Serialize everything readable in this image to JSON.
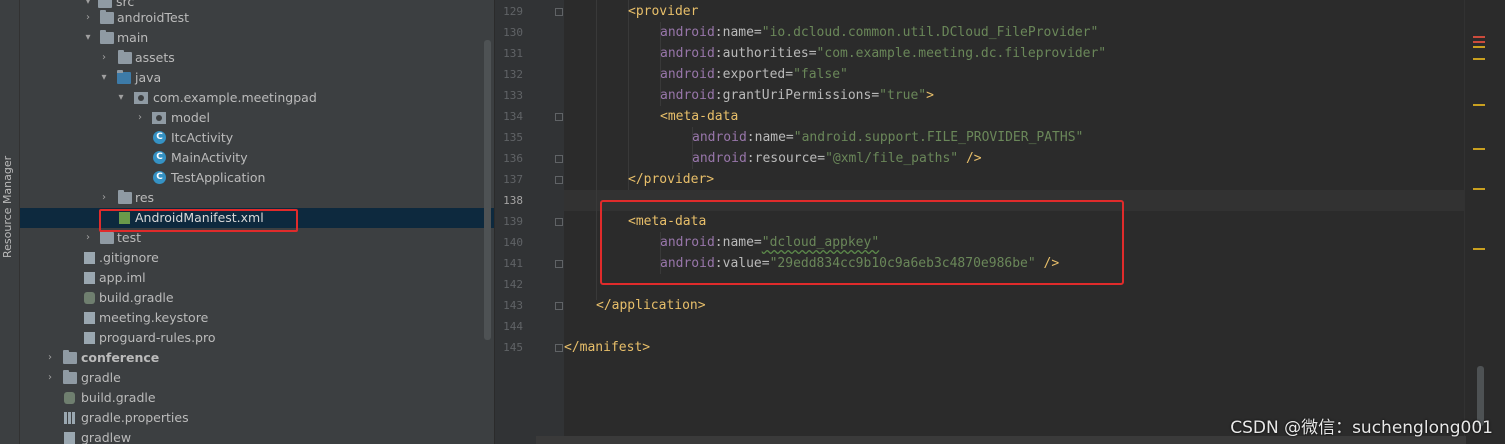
{
  "toolstrip": {
    "label": "Resource Manager"
  },
  "tree": {
    "items": [
      {
        "label": "src",
        "chev": "▾"
      },
      {
        "label": "androidTest",
        "chev": "›"
      },
      {
        "label": "main",
        "chev": "▾"
      },
      {
        "label": "assets",
        "chev": "›"
      },
      {
        "label": "java",
        "chev": "▾"
      },
      {
        "label": "com.example.meetingpad",
        "chev": "▾"
      },
      {
        "label": "model",
        "chev": "›"
      },
      {
        "label": "ItcActivity",
        "chev": ""
      },
      {
        "label": "MainActivity",
        "chev": ""
      },
      {
        "label": "TestApplication",
        "chev": ""
      },
      {
        "label": "res",
        "chev": "›"
      },
      {
        "label": "AndroidManifest.xml",
        "chev": ""
      },
      {
        "label": "test",
        "chev": "›"
      },
      {
        "label": ".gitignore",
        "chev": ""
      },
      {
        "label": "app.iml",
        "chev": ""
      },
      {
        "label": "build.gradle",
        "chev": ""
      },
      {
        "label": "meeting.keystore",
        "chev": ""
      },
      {
        "label": "proguard-rules.pro",
        "chev": ""
      },
      {
        "label": "conference",
        "chev": "›"
      },
      {
        "label": "gradle",
        "chev": "›"
      },
      {
        "label": "build.gradle",
        "chev": ""
      },
      {
        "label": "gradle.properties",
        "chev": ""
      },
      {
        "label": "gradlew",
        "chev": ""
      }
    ],
    "class_glyph": "C"
  },
  "editor": {
    "line_numbers": [
      "129",
      "130",
      "131",
      "132",
      "133",
      "134",
      "135",
      "136",
      "137",
      "138",
      "139",
      "140",
      "141",
      "142",
      "143",
      "144",
      "145"
    ],
    "lines": {
      "l129": {
        "tag": "<provider"
      },
      "l130": {
        "ns": "android",
        "attr": ":name=",
        "val": "\"io.dcloud.common.util.DCloud_FileProvider\""
      },
      "l131": {
        "ns": "android",
        "attr": ":authorities=",
        "val": "\"com.example.meeting.dc.fileprovider\""
      },
      "l132": {
        "ns": "android",
        "attr": ":exported=",
        "val": "\"false\""
      },
      "l133": {
        "ns": "android",
        "attr": ":grantUriPermissions=",
        "val": "\"true\"",
        "tail": ">"
      },
      "l134": {
        "tag": "<meta-data"
      },
      "l135": {
        "ns": "android",
        "attr": ":name=",
        "val": "\"android.support.FILE_PROVIDER_PATHS\""
      },
      "l136": {
        "ns": "android",
        "attr": ":resource=",
        "val": "\"@xml/file_paths\"",
        "tail": " />"
      },
      "l137": {
        "tag": "</provider>"
      },
      "l139": {
        "tag": "<meta-data"
      },
      "l140": {
        "ns": "android",
        "attr": ":name=",
        "val": "\"dcloud_appkey\""
      },
      "l141": {
        "ns": "android",
        "attr": ":value=",
        "val": "\"29edd834cc9b10c9a6eb3c4870e986be\"",
        "tail": " />"
      },
      "l143": {
        "tag": "</application>"
      },
      "l145": {
        "tag": "</manifest>"
      }
    }
  },
  "watermark": "CSDN @微信：suchenglong001",
  "colors": {
    "accent_red": "#e02b2b",
    "selection": "#0d293e",
    "tag": "#e8bf6a",
    "string": "#6a8759",
    "namespace": "#9876aa"
  }
}
